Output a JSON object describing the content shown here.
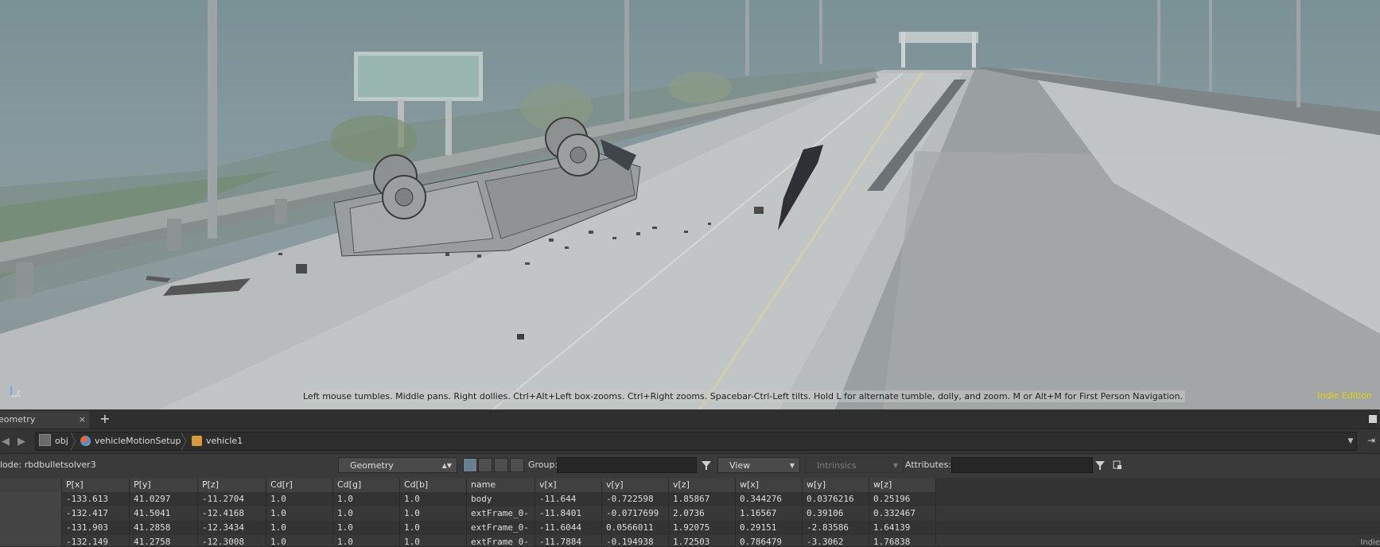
{
  "viewport": {
    "hint": "Left mouse tumbles. Middle pans. Right dollies. Ctrl+Alt+Left box-zooms. Ctrl+Right zooms. Spacebar-Ctrl-Left tilts. Hold L for alternate tumble, dolly, and zoom. M or Alt+M for First Person Navigation.",
    "edition": "Indie Edition",
    "edition_color": "#e8d200"
  },
  "tabs": [
    {
      "label": "eometry Spreadsheet",
      "close": "×"
    }
  ],
  "add_tab": "+",
  "path": [
    {
      "label": "obj",
      "icon": "obj-network-icon"
    },
    {
      "label": "vehicleMotionSetup",
      "icon": "subnet-icon"
    },
    {
      "label": "vehicle1",
      "icon": "geometry-node-icon"
    }
  ],
  "toolbar": {
    "node_label": "lode: rbdbulletsolver3",
    "geometry_combo": "Geometry",
    "group_label": "Group:",
    "view_combo": "View",
    "intrinsics_combo": "Intrinsics",
    "attributes_label": "Attributes:"
  },
  "table": {
    "columns": [
      "P[x]",
      "P[y]",
      "P[z]",
      "Cd[r]",
      "Cd[g]",
      "Cd[b]",
      "name",
      "v[x]",
      "v[y]",
      "v[z]",
      "w[x]",
      "w[y]",
      "w[z]"
    ],
    "rows": [
      [
        "-133.613",
        "41.0297",
        "-11.2704",
        "1.0",
        "1.0",
        "1.0",
        "body",
        "-11.644",
        "-0.722598",
        "1.85867",
        "0.344276",
        "0.0376216",
        "0.25196"
      ],
      [
        "-132.417",
        "41.5041",
        "-12.4168",
        "1.0",
        "1.0",
        "1.0",
        "extFrame_0-",
        "-11.8401",
        "-0.0717699",
        "2.0736",
        "1.16567",
        "0.39106",
        "0.332467"
      ],
      [
        "-131.903",
        "41.2858",
        "-12.3434",
        "1.0",
        "1.0",
        "1.0",
        "extFrame_0-",
        "-11.6044",
        "0.0566011",
        "1.92075",
        "0.29151",
        "-2.83586",
        "1.64139"
      ],
      [
        "-132.149",
        "41.2758",
        "-12.3008",
        "1.0",
        "1.0",
        "1.0",
        "extFrame_0-",
        "-11.7884",
        "-0.194938",
        "1.72503",
        "0.786479",
        "-3.3062",
        "1.76838"
      ]
    ]
  },
  "corner_text": "Indie"
}
